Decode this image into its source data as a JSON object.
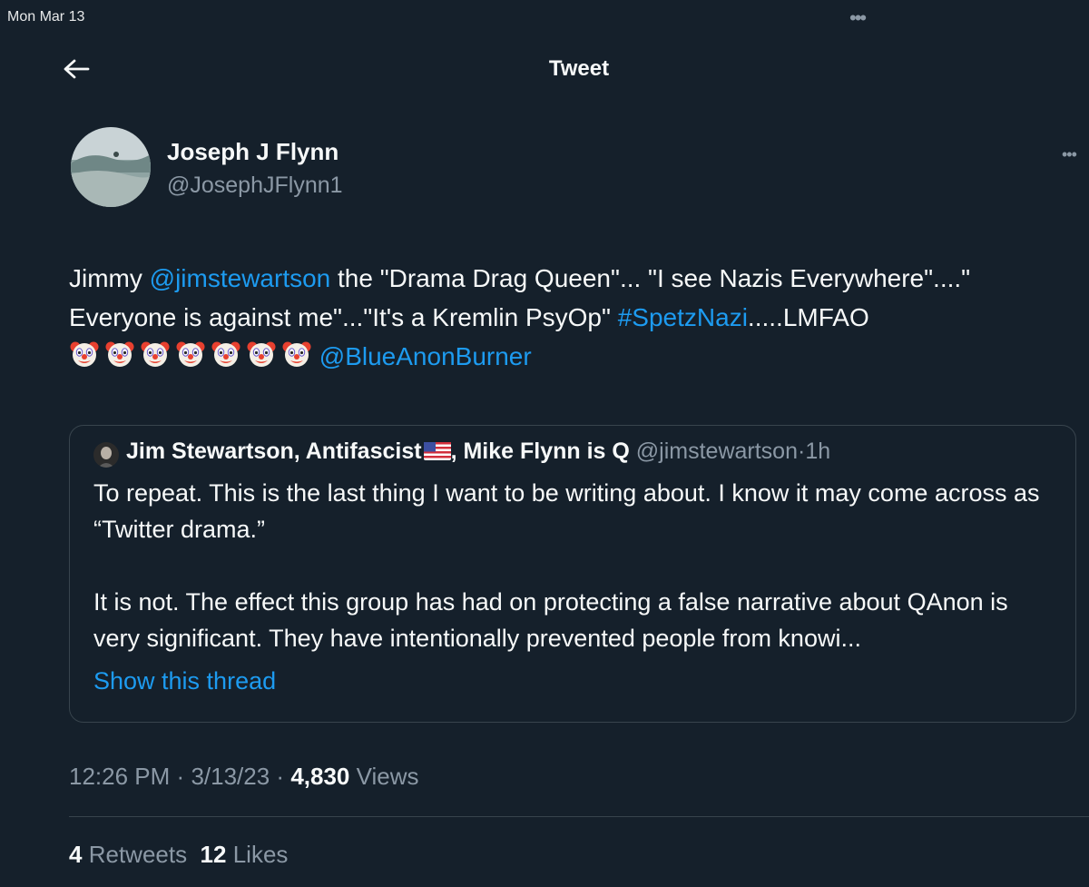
{
  "status_bar": {
    "date": "Mon Mar 13"
  },
  "header": {
    "title": "Tweet"
  },
  "author": {
    "name": "Joseph J Flynn",
    "handle": "@JosephJFlynn1"
  },
  "tweet": {
    "t1": "Jimmy ",
    "mention1": "@jimstewartson",
    "t2": " the \"Drama Drag Queen\"... \"I see Nazis Everywhere\"....\" Everyone is against me\"...\"It's a Kremlin PsyOp\" ",
    "hashtag": "#SpetzNazi",
    "t3": ".....LMFAO ",
    "emojis": [
      "clown-face",
      "clown-face",
      "clown-face",
      "clown-face",
      "clown-face",
      "clown-face",
      "clown-face"
    ],
    "mention2": "@BlueAnonBurner"
  },
  "quote": {
    "name": "Jim Stewartson, Antifascist",
    "name_suffix": ", Mike Flynn is Q",
    "handle": "@jimstewartson",
    "time": "1h",
    "flag": "us-flag",
    "body": "To repeat. This is the last thing I want to be writing about. I know it may come across as “Twitter drama.”\n\nIt is not. The effect this group has had on protecting a false narrative about QAnon is very significant. They have intentionally prevented people from knowi...",
    "show_thread": "Show this thread"
  },
  "meta": {
    "time": "12:26 PM",
    "date": "3/13/23",
    "views_count": "4,830",
    "views_label": "Views",
    "separator": "·"
  },
  "stats": {
    "retweets_count": "4",
    "retweets_label": "Retweets",
    "likes_count": "12",
    "likes_label": "Likes"
  },
  "colors": {
    "background": "#15202b",
    "accent": "#1d9bf0",
    "secondary_text": "#8b98a5",
    "border": "#38444d"
  }
}
